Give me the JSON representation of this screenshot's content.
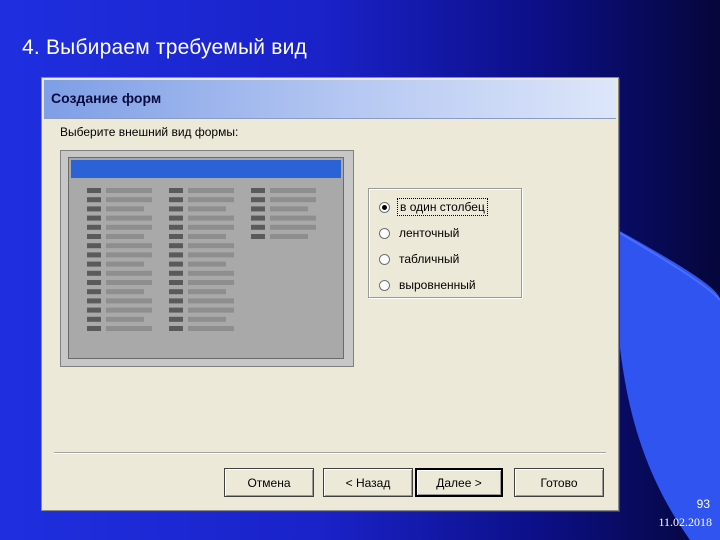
{
  "slide": {
    "title": "4. Выбираем требуемый вид",
    "page_number": "93",
    "date": "11.02.2018"
  },
  "dialog": {
    "heading": "Создание форм",
    "prompt": "Выберите внешний вид формы:",
    "options": [
      {
        "label": "в один столбец",
        "selected": true,
        "focused": true
      },
      {
        "label": "ленточный",
        "selected": false,
        "focused": false
      },
      {
        "label": "табличный",
        "selected": false,
        "focused": false
      },
      {
        "label": "выровненный",
        "selected": false,
        "focused": false
      }
    ],
    "buttons": {
      "cancel": "Отмена",
      "back": "< Назад",
      "next": "Далее >",
      "finish": "Готово"
    }
  },
  "colors": {
    "slide_background": "#1f2fe0",
    "swoosh": "#2f54f0",
    "dialog": "#ece9d8",
    "preview_titlebar": "#2b62d6"
  }
}
